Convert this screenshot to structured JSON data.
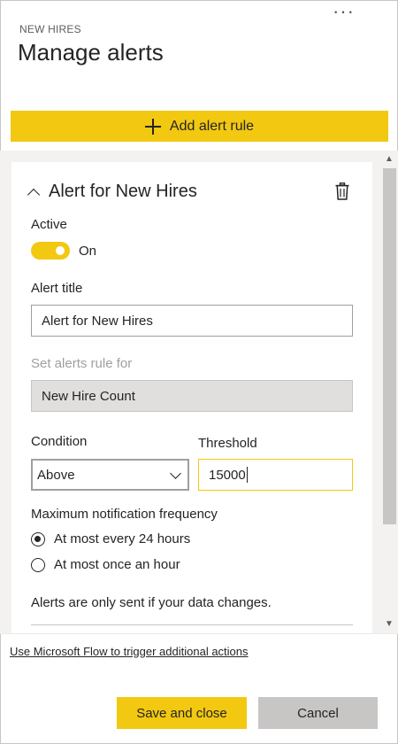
{
  "header": {
    "eyebrow": "NEW HIRES",
    "title": "Manage alerts",
    "more_icon": "more-horizontal-icon"
  },
  "add_rule": {
    "label": "Add alert rule",
    "icon": "plus-icon"
  },
  "rule": {
    "title": "Alert for New Hires",
    "collapse_icon": "chevron-up-icon",
    "delete_icon": "trash-icon",
    "active_label": "Active",
    "active_state": "On",
    "alert_title_label": "Alert title",
    "alert_title_value": "Alert for New Hires",
    "rule_for_label": "Set alerts rule for",
    "rule_for_value": "New Hire Count",
    "condition_label": "Condition",
    "condition_value": "Above",
    "threshold_label": "Threshold",
    "threshold_value": "15000",
    "frequency_label": "Maximum notification frequency",
    "frequency_options": [
      {
        "label": "At most every 24 hours",
        "checked": true
      },
      {
        "label": "At most once an hour",
        "checked": false
      }
    ],
    "note": "Alerts are only sent if your data changes."
  },
  "flow_link": "Use Microsoft Flow to trigger additional actions",
  "footer": {
    "save_label": "Save and close",
    "cancel_label": "Cancel"
  },
  "colors": {
    "accent": "#f2c811",
    "secondary_button": "#c8c6c4",
    "panel_bg": "#f3f2f1"
  }
}
